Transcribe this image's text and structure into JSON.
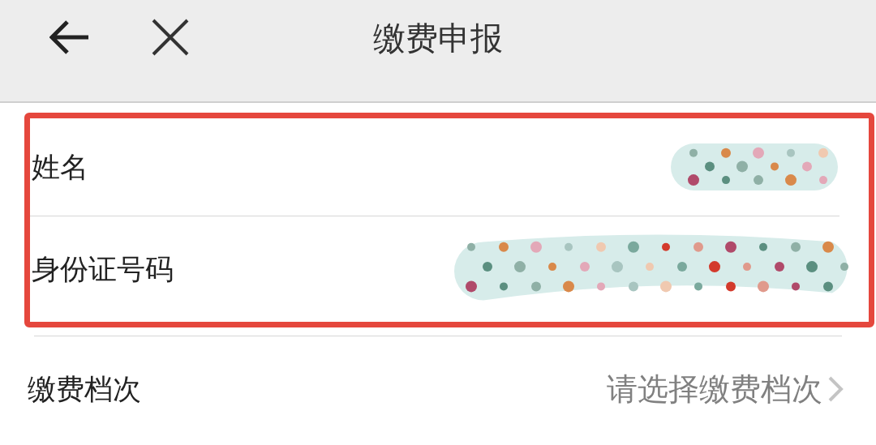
{
  "header": {
    "title": "缴费申报"
  },
  "highlighted_rows": [
    {
      "label": "姓名",
      "kind": "redacted"
    },
    {
      "label": "身份证号码",
      "kind": "redacted"
    }
  ],
  "rows": [
    {
      "label": "缴费档次",
      "kind": "select",
      "placeholder": "请选择缴费档次"
    }
  ]
}
